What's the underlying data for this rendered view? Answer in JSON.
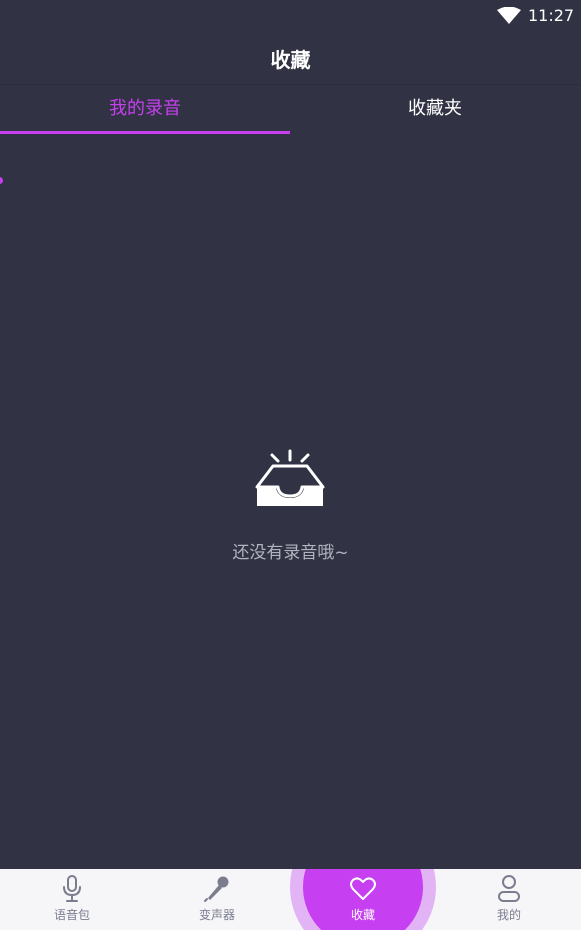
{
  "status_bar": {
    "time": "11:27",
    "wifi_icon": "wifi-icon"
  },
  "header": {
    "title": "收藏"
  },
  "tabs": [
    {
      "label": "我的录音",
      "selected": true
    },
    {
      "label": "收藏夹",
      "selected": false
    }
  ],
  "empty_state": {
    "icon": "empty-inbox-icon",
    "message": "还没有录音哦~"
  },
  "bottom_nav": [
    {
      "label": "语音包",
      "icon": "microphone-icon",
      "active": false
    },
    {
      "label": "变声器",
      "icon": "karaoke-mic-icon",
      "active": false
    },
    {
      "label": "收藏",
      "icon": "heart-icon",
      "active": true
    },
    {
      "label": "我的",
      "icon": "user-icon",
      "active": false
    }
  ],
  "colors": {
    "background": "#313344",
    "accent": "#c83ff0",
    "nav_background": "#f6f6f8",
    "nav_inactive": "#7b7d8e"
  }
}
